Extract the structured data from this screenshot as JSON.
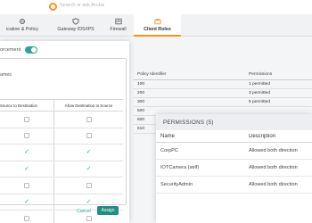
{
  "search": {
    "placeholder": "Search or ask Aruba"
  },
  "tabs": [
    {
      "label": "ication & Policy",
      "icon": "gear-icon",
      "active": false
    },
    {
      "label": "Gateway IDS/IPS",
      "icon": "shield-icon",
      "active": false
    },
    {
      "label": "Firewall",
      "icon": "firewall-icon",
      "active": false
    },
    {
      "label": "Client Roles",
      "icon": "briefcase-icon",
      "active": true
    }
  ],
  "modal": {
    "enforcement_label": "orcement",
    "toggle_on": true,
    "names_label": "ames",
    "columns": [
      "Source to Destination",
      "Allow Destination to Source"
    ],
    "rows": [
      {
        "src": false,
        "dst": false
      },
      {
        "src": false,
        "dst": false
      },
      {
        "src": true,
        "dst": true
      },
      {
        "src": true,
        "dst": true
      },
      {
        "src": false,
        "dst": false
      },
      {
        "src": true,
        "dst": true
      },
      {
        "src": false,
        "dst": false
      }
    ],
    "cancel_label": "Cancel",
    "assign_label": "Assign"
  },
  "policy_table": {
    "columns": [
      "Policy Identifier",
      "Permissions"
    ],
    "rows": [
      {
        "id": "100",
        "perm": "1 permitted"
      },
      {
        "id": "200",
        "perm": "3 permitted"
      },
      {
        "id": "300",
        "perm": "5 permitted"
      },
      {
        "id": "500",
        "perm": ""
      },
      {
        "id": "600",
        "perm": ""
      },
      {
        "id": "610",
        "perm": ""
      }
    ]
  },
  "permissions": {
    "title": "PERMISSIONS (5)",
    "columns": [
      "Name",
      "Description"
    ],
    "rows": [
      {
        "name": "CorpPC",
        "desc": "Allowed both direction"
      },
      {
        "name": "IOTCamera (self)",
        "desc": "Allowed both direction"
      },
      {
        "name": "SecurityAdmin",
        "desc": "Allowed both direction"
      }
    ]
  },
  "colors": {
    "accent": "#f7931e",
    "teal": "#2aa693",
    "button": "#1f8f80"
  }
}
